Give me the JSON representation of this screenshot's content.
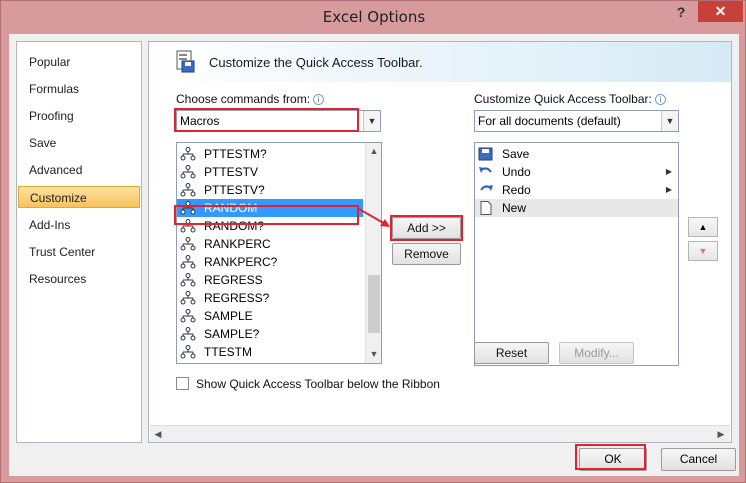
{
  "window": {
    "title": "Excel Options",
    "help_glyph": "?",
    "close_glyph": "✕"
  },
  "nav": {
    "items": [
      {
        "label": "Popular"
      },
      {
        "label": "Formulas"
      },
      {
        "label": "Proofing"
      },
      {
        "label": "Save"
      },
      {
        "label": "Advanced"
      },
      {
        "label": "Customize",
        "active": true
      },
      {
        "label": "Add-Ins"
      },
      {
        "label": "Trust Center"
      },
      {
        "label": "Resources"
      }
    ]
  },
  "banner": {
    "title": "Customize the Quick Access Toolbar."
  },
  "choose": {
    "label": "Choose commands from:",
    "value": "Macros",
    "commands": [
      "PTTESTM?",
      "PTTESTV",
      "PTTESTV?",
      "RANDOM",
      "RANDOM?",
      "RANKPERC",
      "RANKPERC?",
      "REGRESS",
      "REGRESS?",
      "SAMPLE",
      "SAMPLE?",
      "TTESTM"
    ],
    "selected": "RANDOM"
  },
  "customize": {
    "label": "Customize Quick Access Toolbar:",
    "value": "For all documents (default)",
    "items": [
      {
        "label": "Save",
        "icon": "save-icon"
      },
      {
        "label": "Undo",
        "icon": "undo-icon",
        "submenu": true
      },
      {
        "label": "Redo",
        "icon": "redo-icon",
        "submenu": true
      },
      {
        "label": "New",
        "icon": "new-document-icon"
      }
    ]
  },
  "buttons": {
    "add": "Add >>",
    "remove": "Remove",
    "reset": "Reset",
    "modify": "Modify...",
    "ok": "OK",
    "cancel": "Cancel"
  },
  "checkbox": {
    "label": "Show Quick Access Toolbar below the Ribbon",
    "checked": false
  },
  "colors": {
    "highlight": "#e0232e",
    "selection": "#3399ff",
    "nav_active": "#f9c25b"
  }
}
